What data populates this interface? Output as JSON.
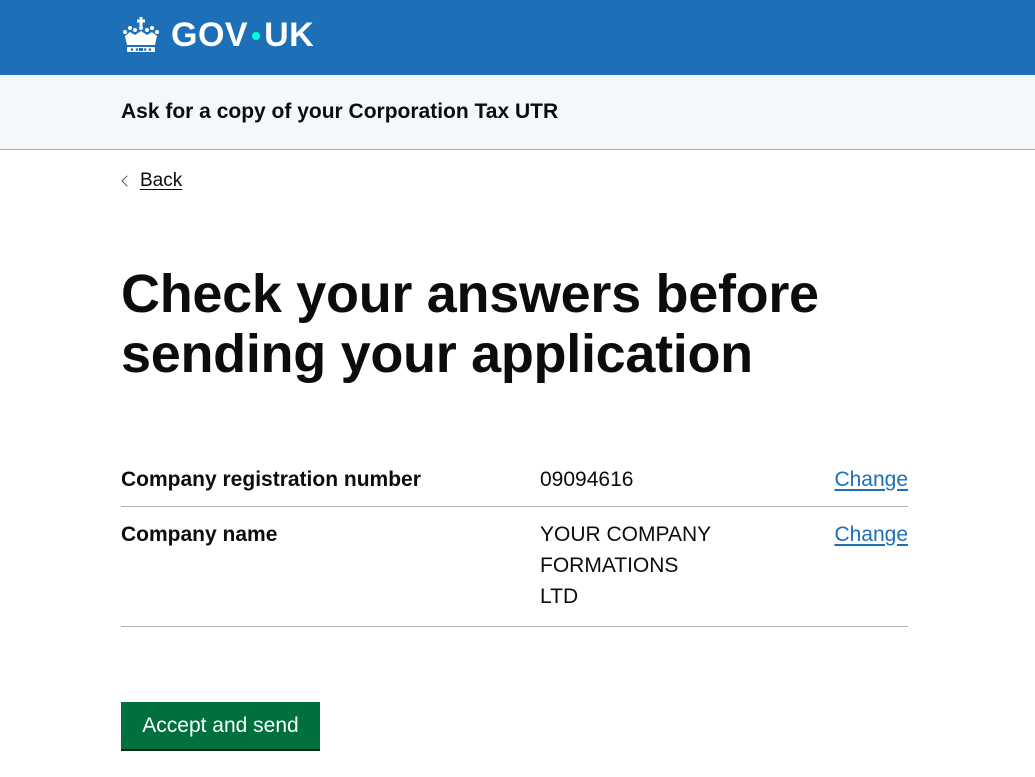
{
  "header": {
    "logo_left": "GOV",
    "logo_right": "UK",
    "logo_icon": "crown-icon",
    "dot_color": "#00ffe0",
    "background_color": "#1d70b8"
  },
  "service": {
    "name": "Ask for a copy of your Corporation Tax UTR"
  },
  "back_link": {
    "label": "Back",
    "icon": "chevron-left-icon"
  },
  "page": {
    "title": "Check your answers before sending your application"
  },
  "summary": {
    "rows": [
      {
        "key": "Company registration number",
        "value_lines": [
          "09094616"
        ],
        "action": "Change"
      },
      {
        "key": "Company name",
        "value_lines": [
          "YOUR COMPANY",
          "FORMATIONS",
          "LTD"
        ],
        "action": "Change"
      }
    ]
  },
  "actions": {
    "submit_label": "Accept and send",
    "button_color": "#00703c"
  }
}
